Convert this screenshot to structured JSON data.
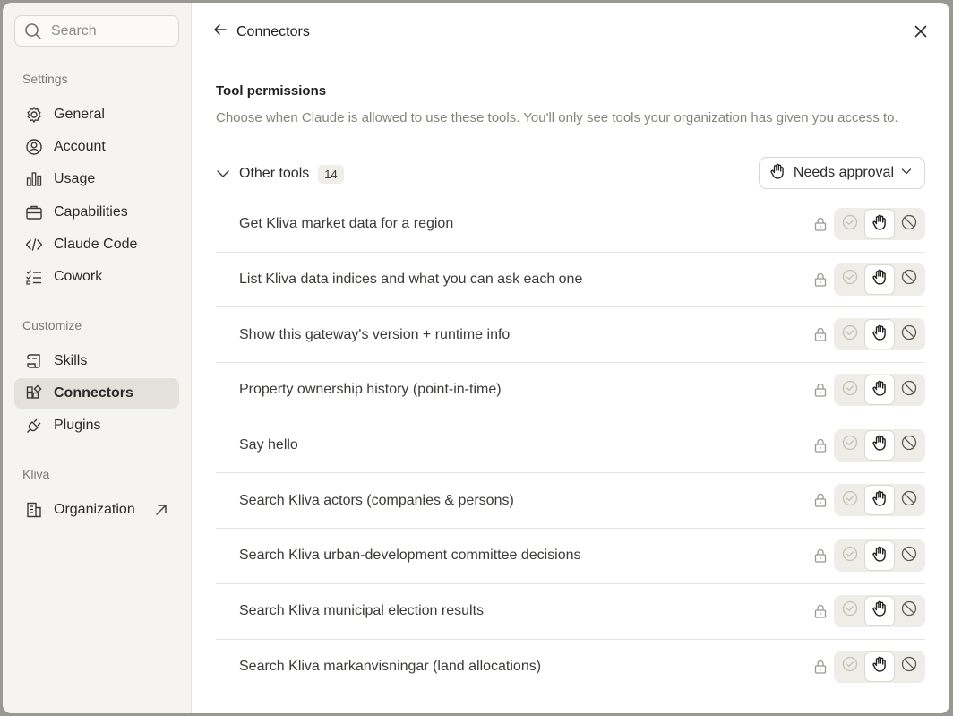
{
  "search": {
    "placeholder": "Search"
  },
  "sidebar": {
    "sections": [
      {
        "label": "Settings"
      },
      {
        "label": "Customize"
      },
      {
        "label": "Kliva"
      }
    ],
    "items": [
      {
        "label": "General",
        "icon": "gear-icon"
      },
      {
        "label": "Account",
        "icon": "user-circle-icon"
      },
      {
        "label": "Usage",
        "icon": "bar-chart-icon"
      },
      {
        "label": "Capabilities",
        "icon": "briefcase-icon"
      },
      {
        "label": "Claude Code",
        "icon": "code-icon"
      },
      {
        "label": "Cowork",
        "icon": "checklist-icon"
      },
      {
        "label": "Skills",
        "icon": "scroll-icon"
      },
      {
        "label": "Connectors",
        "icon": "connectors-icon",
        "active": true
      },
      {
        "label": "Plugins",
        "icon": "plug-icon"
      },
      {
        "label": "Organization",
        "icon": "building-icon"
      }
    ]
  },
  "header": {
    "title": "Connectors"
  },
  "permissions": {
    "title": "Tool permissions",
    "description": "Choose when Claude is allowed to use these tools. You'll only see tools your organization has given you access to.",
    "group": {
      "name": "Other tools",
      "count": "14"
    },
    "dropdown": {
      "label": "Needs approval"
    },
    "tools": [
      {
        "name": "Get Kliva market data for a region"
      },
      {
        "name": "List Kliva data indices and what you can ask each one"
      },
      {
        "name": "Show this gateway's version + runtime info"
      },
      {
        "name": "Property ownership history (point-in-time)"
      },
      {
        "name": "Say hello"
      },
      {
        "name": "Search Kliva actors (companies & persons)"
      },
      {
        "name": "Search Kliva urban-development committee decisions"
      },
      {
        "name": "Search Kliva municipal election results"
      },
      {
        "name": "Search Kliva markanvisningar (land allocations)"
      }
    ]
  },
  "colors": {
    "active_nav_bg": "#e3e1da",
    "sidebar_bg": "#f5f4f0",
    "selected_segment": "#ffffff"
  }
}
